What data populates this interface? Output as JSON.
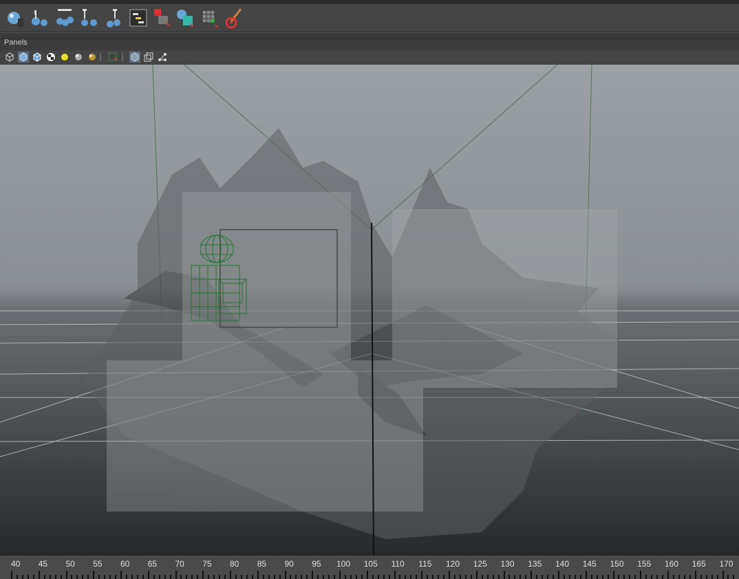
{
  "menu": {
    "panels_label": "Panels"
  },
  "shelf": {
    "icons": [
      "create-sphere-icon",
      "delete-history-icon",
      "joint-tool-icon",
      "ik-handle-icon",
      "bind-skin-icon",
      "paint-weights-icon",
      "hypergraph-icon",
      "select-component-icon",
      "render-view-icon",
      "uv-editor-icon",
      "paint-effects-icon"
    ]
  },
  "viewport_toolbar": {
    "icons": [
      "wireframe-icon",
      "smooth-shade-icon",
      "textured-icon",
      "checker-icon",
      "light-icon",
      "default-material-icon",
      "shaded-material-icon",
      "select-camera-icon",
      "isolate-icon",
      "xray-icon",
      "resolution-gate-icon"
    ]
  },
  "timeline": {
    "labels": [
      "40",
      "45",
      "50",
      "55",
      "60",
      "65",
      "70",
      "75",
      "80",
      "85",
      "90",
      "95",
      "100",
      "105",
      "110",
      "115",
      "120",
      "125",
      "130",
      "135",
      "140",
      "145",
      "150",
      "155",
      "160",
      "165",
      "170"
    ],
    "current_frame": "105"
  },
  "colors": {
    "viewport_top": "#9a9fa3",
    "viewport_bottom": "#2a2d30",
    "wireframe": "#1d7a2c"
  }
}
